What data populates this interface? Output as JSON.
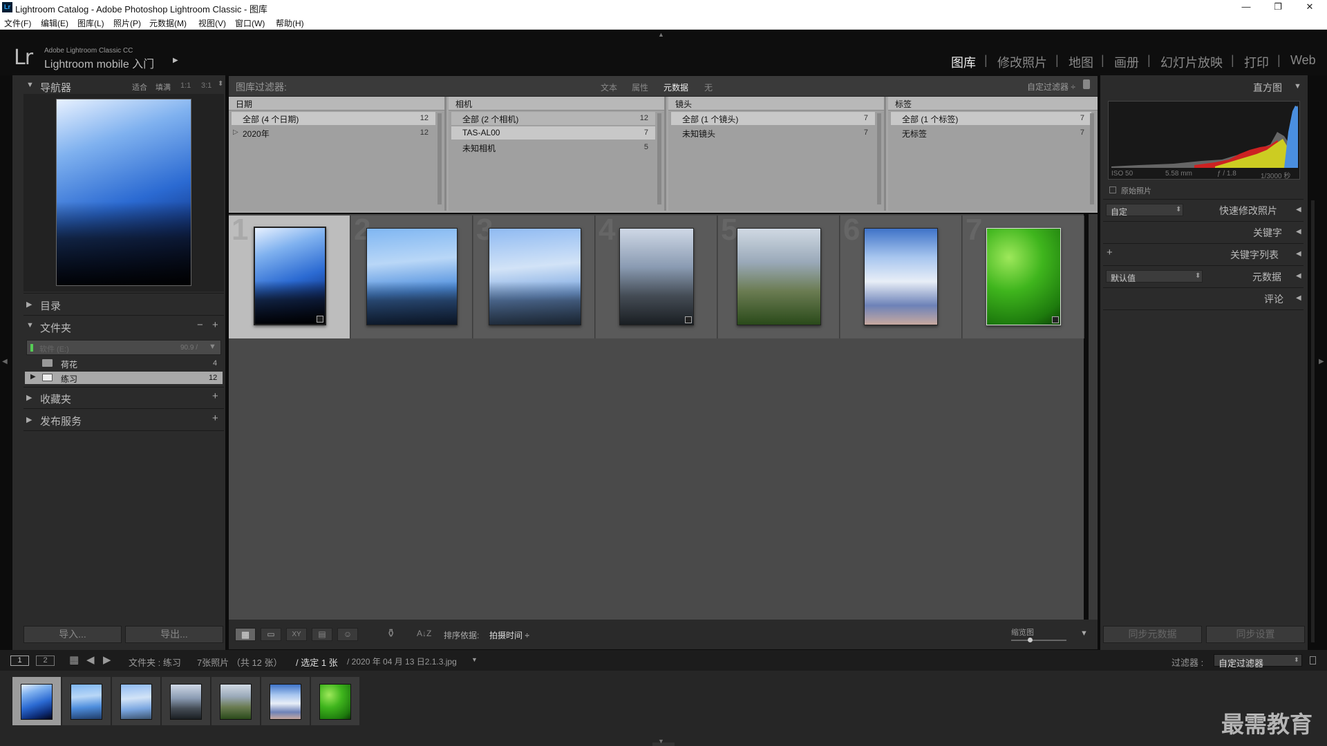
{
  "window": {
    "title": "Lightroom Catalog - Adobe Photoshop Lightroom Classic - 图库",
    "app_icon": "Lr"
  },
  "menu": [
    "文件(F)",
    "编辑(E)",
    "图库(L)",
    "照片(P)",
    "元数据(M)",
    "视图(V)",
    "窗口(W)",
    "帮助(H)"
  ],
  "header": {
    "logo": "Lr",
    "brand_small": "Adobe Lightroom Classic CC",
    "brand_big": "Lightroom mobile 入门",
    "play": "▶"
  },
  "modules": [
    "图库",
    "修改照片",
    "地图",
    "画册",
    "幻灯片放映",
    "打印",
    "Web"
  ],
  "module_sep": "|",
  "navigator": {
    "title": "导航器",
    "zoom": [
      "适合",
      "填满",
      "1:1",
      "3:1"
    ]
  },
  "sections": {
    "catalog": "目录",
    "folders": "文件夹",
    "collections": "收藏夹",
    "publish": "发布服务"
  },
  "volume": {
    "name": "软件 (E:)",
    "size": "90.9 /"
  },
  "folders": [
    {
      "name": "荷花",
      "count": "4"
    },
    {
      "name": "练习",
      "count": "12"
    }
  ],
  "left_buttons": {
    "import": "导入...",
    "export": "导出..."
  },
  "filter_bar": {
    "label": "图库过滤器:",
    "tabs": [
      "文本",
      "属性",
      "元数据",
      "无"
    ],
    "active": "元数据",
    "preset": "自定过滤器 ÷"
  },
  "filter_columns": [
    {
      "title": "日期",
      "rows": [
        {
          "label": "全部 (4 个日期)",
          "count": "12",
          "selected": true
        },
        {
          "label": "2020年",
          "count": "12",
          "expand": "▷"
        }
      ]
    },
    {
      "title": "相机",
      "rows": [
        {
          "label": "全部 (2 个相机)",
          "count": "12"
        },
        {
          "label": "TAS-AL00",
          "count": "7",
          "selected": true
        },
        {
          "label": "未知相机",
          "count": "5"
        }
      ]
    },
    {
      "title": "镜头",
      "rows": [
        {
          "label": "全部 (1 个镜头)",
          "count": "7",
          "selected": true
        },
        {
          "label": "未知镜头",
          "count": "7"
        }
      ]
    },
    {
      "title": "标签",
      "rows": [
        {
          "label": "全部 (1 个标签)",
          "count": "7",
          "selected": true
        },
        {
          "label": "无标签",
          "count": "7"
        }
      ]
    }
  ],
  "grid": {
    "numbers": [
      "1",
      "2",
      "3",
      "4",
      "5",
      "6",
      "7"
    ]
  },
  "toolbar": {
    "sort_label": "排序依据:",
    "sort_value": "拍摄时间 ÷",
    "thumb_label": "缩览图",
    "az": "A↓Z"
  },
  "histogram": {
    "title": "直方图",
    "iso": "ISO 50",
    "focal": "5.58 mm",
    "fstop": "ƒ / 1.8",
    "shutter": "1/3000 秒",
    "original": "原始照片"
  },
  "right_sections": {
    "quick_develop": "快速修改照片",
    "quick_preset": "自定",
    "keywords": "关键字",
    "keyword_list": "关键字列表",
    "metadata": "元数据",
    "metadata_preset": "默认值",
    "comments": "评论"
  },
  "right_buttons": {
    "sync_meta": "同步元数据",
    "sync_settings": "同步设置"
  },
  "filmstrip": {
    "page1": "1",
    "page2": "2",
    "path": "文件夹 : 练习",
    "count": "7张照片 （共 12 张）",
    "selected": "/ 选定 1 张",
    "file": "/ 2020 年 04 月 13 日2.1.3.jpg",
    "filter_label": "过滤器 :",
    "filter_value": "自定过滤器"
  },
  "watermark": "最需教育"
}
